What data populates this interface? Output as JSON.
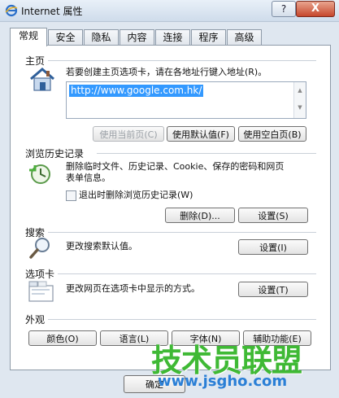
{
  "window": {
    "title": "Internet 属性",
    "help_glyph": "?",
    "close_glyph": "X"
  },
  "tabs": [
    {
      "label": "常规",
      "active": true
    },
    {
      "label": "安全"
    },
    {
      "label": "隐私"
    },
    {
      "label": "内容"
    },
    {
      "label": "连接"
    },
    {
      "label": "程序"
    },
    {
      "label": "高级"
    }
  ],
  "home": {
    "group_label": "主页",
    "description": "若要创建主页选项卡，请在各地址行键入地址(R)。",
    "url": "http://www.google.com.hk/",
    "use_current": "使用当前页(C)",
    "use_default": "使用默认值(F)",
    "use_blank": "使用空白页(B)"
  },
  "history": {
    "group_label": "浏览历史记录",
    "description_line1": "删除临时文件、历史记录、Cookie、保存的密码和网页",
    "description_line2": "表单信息。",
    "checkbox_label": "退出时删除浏览历史记录(W)",
    "checkbox_checked": false,
    "delete_button": "删除(D)...",
    "settings_button": "设置(S)"
  },
  "search": {
    "group_label": "搜索",
    "description": "更改搜索默认值。",
    "settings_button": "设置(I)"
  },
  "tabs_group": {
    "group_label": "选项卡",
    "description": "更改网页在选项卡中显示的方式。",
    "settings_button": "设置(T)"
  },
  "appearance": {
    "group_label": "外观",
    "colors_button": "颜色(O)",
    "languages_button": "语言(L)",
    "fonts_button": "字体(N)",
    "accessibility_button": "辅助功能(E)"
  },
  "footer": {
    "ok_button": "确定"
  },
  "watermark": {
    "brand": "技术员联盟",
    "url": "www.jsgho.com"
  }
}
